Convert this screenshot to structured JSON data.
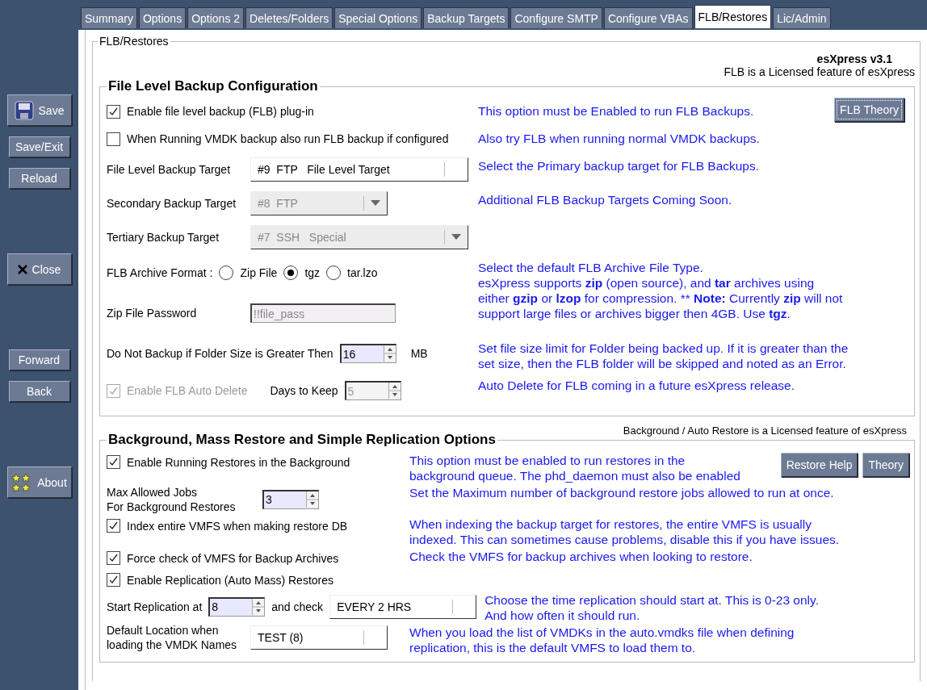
{
  "sidebar": {
    "groups": [
      [
        {
          "label": "Save",
          "kind": "save"
        },
        {
          "label": "Save/Exit",
          "kind": "plain"
        },
        {
          "label": "Reload",
          "kind": "plain"
        }
      ],
      [
        {
          "label": "Close",
          "kind": "close"
        }
      ],
      [
        {
          "label": "Forward",
          "kind": "plain"
        },
        {
          "label": "Back",
          "kind": "plain"
        }
      ],
      [
        {
          "label": "About",
          "kind": "about"
        }
      ]
    ]
  },
  "tabs": [
    {
      "label": "Summary",
      "selected": false
    },
    {
      "label": "Options",
      "selected": false
    },
    {
      "label": "Options 2",
      "selected": false
    },
    {
      "label": "Deletes/Folders",
      "selected": false
    },
    {
      "label": "Special Options",
      "selected": false
    },
    {
      "label": "Backup Targets",
      "selected": false
    },
    {
      "label": "Configure SMTP",
      "selected": false
    },
    {
      "label": "Configure VBAs",
      "selected": false
    },
    {
      "label": "FLB/Restores",
      "selected": true
    },
    {
      "label": "Lic/Admin",
      "selected": false
    }
  ],
  "frame": {
    "title": "FLB/Restores",
    "version": "esXpress v3.1",
    "license_note": "FLB is a Licensed feature of esXpress"
  },
  "flb": {
    "title": "File Level Backup Configuration",
    "buttons": [
      "FLB Theory"
    ],
    "groups": [
      {
        "controls": [
          {
            "kind": "checkbox",
            "label": "Enable file level backup (FLB) plug-in",
            "checked": true,
            "disabled": false
          }
        ],
        "help": "This option must be Enabled to run FLB Backups."
      },
      {
        "controls": [
          {
            "kind": "checkbox",
            "label": "When Running VMDK backup also run FLB backup if configured",
            "checked": false,
            "disabled": false
          }
        ],
        "help": "Also try FLB when running normal VMDK backups."
      },
      {
        "controls": [
          {
            "kind": "select",
            "label": "File Level Backup Target",
            "value": "#9  FTP   File Level Target",
            "disabled": false
          }
        ],
        "help": "Select the Primary backup target for FLB Backups."
      },
      {
        "controls": [
          {
            "kind": "select",
            "label": "Secondary Backup Target",
            "value": "#8  FTP",
            "disabled": true
          }
        ],
        "help": "Additional FLB Backup Targets Coming Soon."
      },
      {
        "controls": [
          {
            "kind": "select",
            "label": "Tertiary Backup Target",
            "value": "#7  SSH   Special",
            "disabled": true
          }
        ]
      },
      {
        "controls": [
          {
            "kind": "radio",
            "label": "FLB Archive Format :",
            "options": [
              {
                "label": "Zip File",
                "selected": false
              },
              {
                "label": "tgz",
                "selected": true
              },
              {
                "label": "tar.lzo",
                "selected": false
              }
            ]
          },
          {
            "kind": "text",
            "label": "Zip File Password",
            "value": "!!file_pass",
            "disabled": true
          }
        ],
        "help": "Select the default FLB Archive File Type.\nesXpress supports **zip** (open source), and **tar** archives using\neither **gzip** or **lzop** for compression.  ** **Note:** Currently **zip** will not\nsupport large files or archives bigger then 4GB. Use **tgz**."
      },
      {
        "controls": [
          {
            "kind": "spin",
            "label": "Do Not Backup if Folder Size is Greater Then",
            "value": "16",
            "unit": "MB",
            "disabled": false
          }
        ],
        "help": "Set file size limit for Folder being backed up. If it is greater than the\nset size, then the FLB folder will be skipped and noted as an Error."
      },
      {
        "controls": [
          {
            "kind": "autodelete",
            "label": "Enable FLB Auto Delete",
            "checked": true,
            "disabled": true,
            "days_label": "Days to Keep",
            "days": "5"
          }
        ],
        "help": "Auto Delete for FLB coming in a future esXpress release."
      }
    ]
  },
  "restore": {
    "title": "Background, Mass Restore and Simple Replication Options",
    "license_note": "Background / Auto Restore is a Licensed feature of esXpress",
    "buttons": [
      "Restore Help",
      "Theory"
    ],
    "groups": [
      {
        "controls": [
          {
            "kind": "checkbox",
            "label": "Enable Running Restores in the Background",
            "checked": true,
            "disabled": false
          }
        ],
        "help": "This option must be enabled to run restores in the\nbackground queue. The phd_daemon must also be enabled"
      },
      {
        "controls": [
          {
            "kind": "spin",
            "label": "Max Allowed Jobs\nFor Background Restores",
            "value": "3",
            "disabled": false
          }
        ],
        "help": "Set the Maximum number of background restore jobs allowed to run at once."
      },
      {
        "controls": [
          {
            "kind": "checkbox",
            "label": "Index entire VMFS when making restore DB",
            "checked": true,
            "disabled": false
          }
        ],
        "help": "When indexing the backup target for restores, the entire VMFS is usually\nindexed. This can sometimes cause problems, disable this if you have issues."
      },
      {
        "controls": [
          {
            "kind": "checkbox",
            "label": "Force check of VMFS for Backup Archives",
            "checked": true,
            "disabled": false
          }
        ],
        "help": "Check the VMFS for backup archives when looking to restore."
      },
      {
        "controls": [
          {
            "kind": "checkbox",
            "label": "Enable Replication (Auto Mass) Restores",
            "checked": true,
            "disabled": false
          }
        ]
      },
      {
        "controls": [
          {
            "kind": "replication",
            "label": "Start Replication at",
            "value": "8",
            "check_label": "and check",
            "interval": "EVERY 2 HRS"
          }
        ],
        "help": "Choose the time replication should start at. This is 0-23 only.\nAnd how often it should run."
      },
      {
        "controls": [
          {
            "kind": "select",
            "label": "Default Location when\nloading the VMDK Names",
            "value": "TEST (8)",
            "disabled": false
          }
        ],
        "help": "When you load the list of VMDKs in the auto.vmdks file when defining\nreplication, this is the default VMFS to load them to."
      }
    ]
  }
}
